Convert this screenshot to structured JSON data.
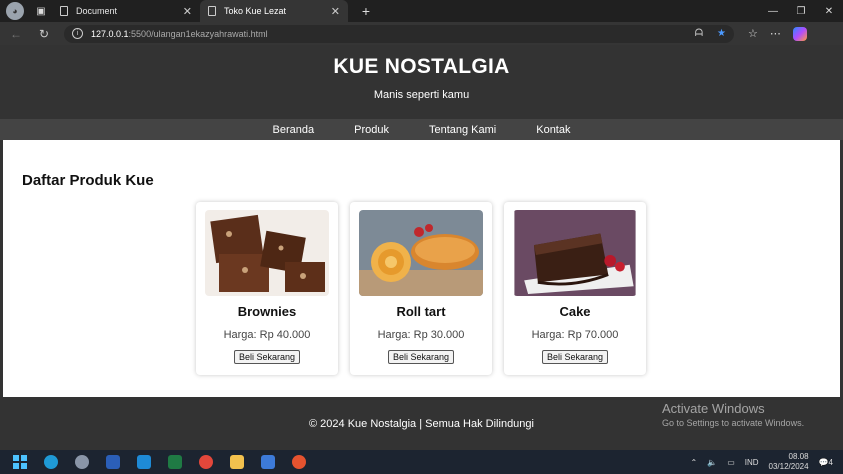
{
  "browser": {
    "tabs": [
      {
        "label": "Document",
        "active": false
      },
      {
        "label": "Toko Kue Lezat",
        "active": true
      }
    ],
    "address": {
      "host": "127.0.0.1",
      "path": ":5500/ulangan1ekazyahrawati.html"
    }
  },
  "site": {
    "title": "KUE NOSTALGIA",
    "tagline": "Manis seperti kamu",
    "nav": [
      "Beranda",
      "Produk",
      "Tentang Kami",
      "Kontak"
    ],
    "section_title": "Daftar Produk Kue",
    "products": [
      {
        "name": "Brownies",
        "price": "Harga: Rp 40.000",
        "button": "Beli Sekarang"
      },
      {
        "name": "Roll tart",
        "price": "Harga: Rp 30.000",
        "button": "Beli Sekarang"
      },
      {
        "name": "Cake",
        "price": "Harga: Rp 70.000",
        "button": "Beli Sekarang"
      }
    ],
    "footer": "© 2024 Kue Nostalgia | Semua Hak Dilindungi"
  },
  "watermark": {
    "line1": "Activate Windows",
    "line2": "Go to Settings to activate Windows."
  },
  "taskbar": {
    "lang": "IND",
    "time": "08.08",
    "date": "03/12/2024",
    "notifications": "4"
  },
  "colors": {
    "header": "#333333",
    "nav": "#444444",
    "accent_star": "#4c9aff"
  }
}
